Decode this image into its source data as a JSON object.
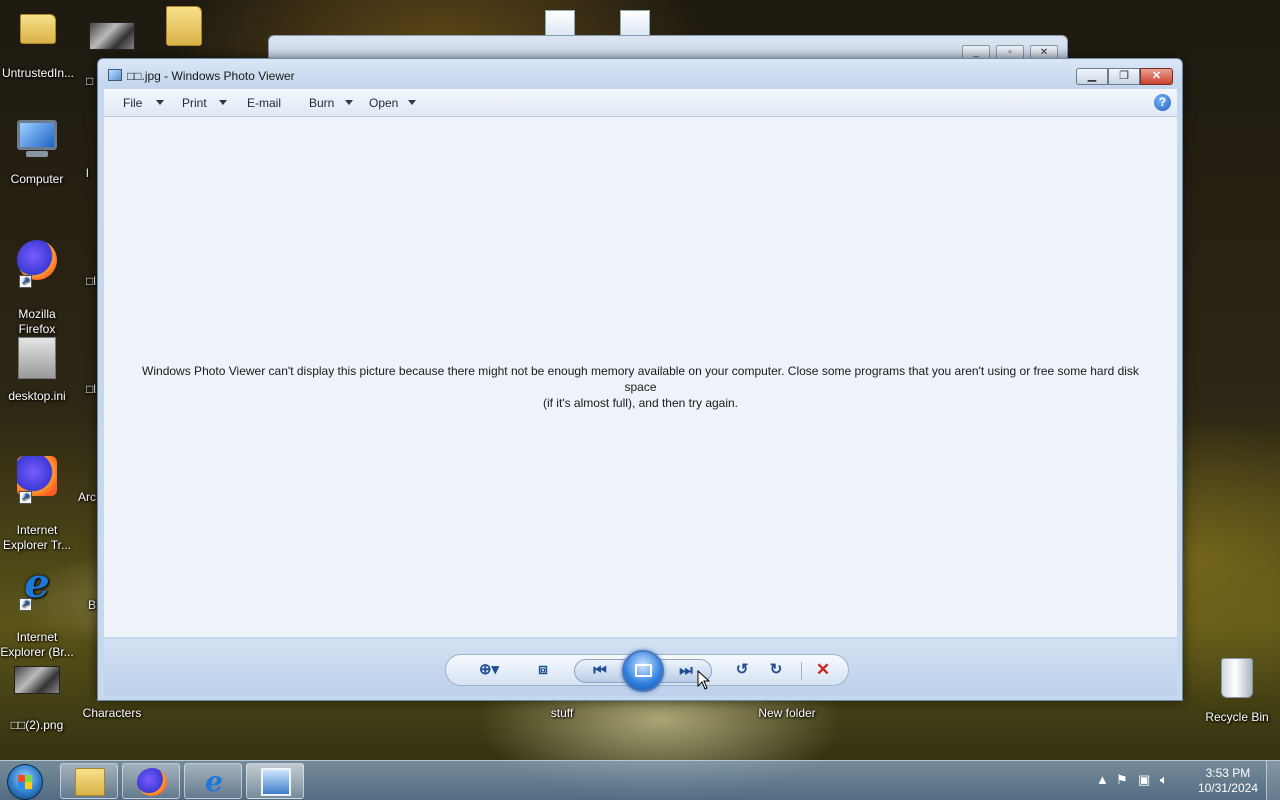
{
  "desktop": {
    "icons": [
      {
        "label": "UntrustedIn...",
        "icon": "folder-user-icon"
      },
      {
        "label": "Computer",
        "icon": "computer-icon"
      },
      {
        "label": "Mozilla\nFirefox",
        "icon": "firefox-icon"
      },
      {
        "label": "desktop.ini",
        "icon": "settings-file-icon"
      },
      {
        "label": "Internet\nExplorer Tr...",
        "icon": "firefox-icon"
      },
      {
        "label": "Internet\nExplorer (Br...",
        "icon": "internet-explorer-icon"
      },
      {
        "label": "□□(2).png",
        "icon": "image-file-icon"
      },
      {
        "label": "Characters",
        "icon": "folder-icon"
      },
      {
        "label": "stuff",
        "icon": "folder-icon"
      },
      {
        "label": "New folder",
        "icon": "folder-icon"
      },
      {
        "label": "Recycle Bin",
        "icon": "recycle-bin-icon"
      },
      {
        "label": "□",
        "icon": "image-file-icon"
      },
      {
        "label": "l",
        "icon": "image-file-icon"
      },
      {
        "label": "□l",
        "icon": "image-file-icon"
      },
      {
        "label": "□l",
        "icon": "image-file-icon"
      },
      {
        "label": "Arc",
        "icon": "folder-icon"
      },
      {
        "label": "B",
        "icon": "image-file-icon"
      }
    ]
  },
  "photo_viewer": {
    "title": "□□.jpg - Windows Photo Viewer",
    "menu": {
      "file": "File",
      "print": "Print",
      "email": "E-mail",
      "burn": "Burn",
      "open": "Open"
    },
    "help": "?",
    "message_line1": "Windows Photo Viewer can't display this picture because there might not be enough memory available on your computer.  Close some programs that you aren't using or free some hard disk space",
    "message_line2": "(if it's almost full), and then try again.",
    "controls": {
      "zoom": "zoom-icon",
      "actual_size": "actual-size-icon",
      "previous": "previous-icon",
      "slideshow": "slideshow-icon",
      "next": "next-icon",
      "rotate_ccw": "rotate-counterclockwise-icon",
      "rotate_cw": "rotate-clockwise-icon",
      "delete": "delete-icon"
    }
  },
  "taskbar": {
    "apps": [
      "file-explorer-icon",
      "firefox-icon",
      "internet-explorer-icon",
      "photo-viewer-icon"
    ],
    "clock_time": "3:53 PM",
    "clock_date": "10/31/2024"
  },
  "colors": {
    "window_frame": "#c6d8ee",
    "content_bg": "#eef3fa",
    "close_red": "#c7412c",
    "accent_blue": "#1e4f92"
  }
}
